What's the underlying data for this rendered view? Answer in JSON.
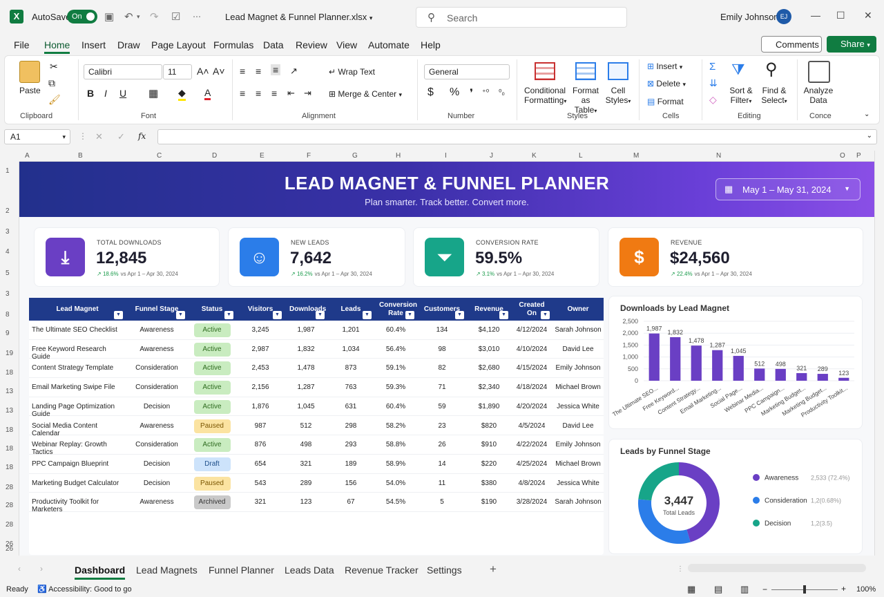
{
  "app": {
    "autosave_label": "AutoSave",
    "autosave_state": "On",
    "doc_title": "Lead Magnet & Funnel Planner.xlsx",
    "search_placeholder": "Search",
    "user_name": "Emily Johnson",
    "user_initials": "EJ",
    "brand_color": "#107c41"
  },
  "menu": [
    "File",
    "Home",
    "Insert",
    "Draw",
    "Page Layout",
    "Formulas",
    "Data",
    "Review",
    "View",
    "Automate",
    "Help"
  ],
  "menu_active": "Home",
  "actions": {
    "comments": "Comments",
    "share": "Share"
  },
  "ribbon": {
    "clipboard": {
      "paste": "Paste",
      "group": "Clipboard"
    },
    "font": {
      "name": "Calibri",
      "size": "11",
      "group": "Font"
    },
    "alignment": {
      "wrap": "Wrap Text",
      "merge": "Merge & Center",
      "group": "Alignment"
    },
    "number": {
      "format": "General",
      "group": "Number"
    },
    "styles": {
      "conditional": "Conditional",
      "conditional2": "Formatting",
      "format_as": "Format as",
      "format_as2": "Table",
      "cell": "Cell",
      "cell2": "Styles",
      "group": "Styles"
    },
    "cells": {
      "insert": "Insert",
      "delete": "Delete",
      "format": "Format",
      "group": "Cells"
    },
    "editing": {
      "sort": "Sort &",
      "sort2": "Filter",
      "find": "Find &",
      "find2": "Select",
      "group": "Editing"
    },
    "analysis": {
      "analyze": "Analyze",
      "analyze2": "Data",
      "group": "Conce"
    }
  },
  "formula_bar": {
    "name_box": "A1",
    "fx": "fx",
    "value": ""
  },
  "columns": [
    "A",
    "B",
    "C",
    "D",
    "E",
    "F",
    "G",
    "H",
    "I",
    "J",
    "K",
    "L",
    "M",
    "N",
    "O",
    "P"
  ],
  "rows": [
    "1",
    "2",
    "3",
    "4",
    "5",
    "3",
    "8",
    "9",
    "19",
    "18",
    "13",
    "13",
    "18",
    "18",
    "18",
    "28",
    "28",
    "28",
    "26",
    "26"
  ],
  "banner": {
    "title": "LEAD MAGNET & FUNNEL PLANNER",
    "subtitle": "Plan smarter. Track better. Convert more.",
    "date_range": "May 1 – May 31, 2024"
  },
  "kpis": [
    {
      "label": "TOTAL DOWNLOADS",
      "value": "12,845",
      "delta": "18.6%",
      "compare": "vs Apr 1 – Apr 30, 2024",
      "color": "#6a3fc4",
      "icon": "download-icon"
    },
    {
      "label": "NEW LEADS",
      "value": "7,642",
      "delta": "16.2%",
      "compare": "vs Apr 1 – Apr 30, 2024",
      "color": "#2b7de9",
      "icon": "users-icon"
    },
    {
      "label": "CONVERSION RATE",
      "value": "59.5%",
      "delta": "3.1%",
      "compare": "vs Apr 1 – Apr 30, 2024",
      "color": "#17a589",
      "icon": "funnel-icon"
    },
    {
      "label": "REVENUE",
      "value": "$24,560",
      "delta": "22.4%",
      "compare": "vs Apr 1 – Apr 30, 2024",
      "color": "#f07a12",
      "icon": "dollar-icon"
    }
  ],
  "table": {
    "headers": [
      "Lead Magnet",
      "Funnel Stage",
      "Status",
      "Visitors",
      "Downloads",
      "Leads",
      "Conversion Rate",
      "Customers",
      "Revenue",
      "Created On",
      "Owner"
    ],
    "rows": [
      [
        "The Ultimate SEO Checklist",
        "Awareness",
        "Active",
        "3,245",
        "1,987",
        "1,201",
        "60.4%",
        "134",
        "$4,120",
        "4/12/2024",
        "Sarah Johnson"
      ],
      [
        "Free Keyword Research Guide",
        "Awareness",
        "Active",
        "2,987",
        "1,832",
        "1,034",
        "56.4%",
        "98",
        "$3,010",
        "4/10/2024",
        "David Lee"
      ],
      [
        "Content Strategy Template",
        "Consideration",
        "Active",
        "2,453",
        "1,478",
        "873",
        "59.1%",
        "82",
        "$2,680",
        "4/15/2024",
        "Emily Johnson"
      ],
      [
        "Email Marketing Swipe File",
        "Consideration",
        "Active",
        "2,156",
        "1,287",
        "763",
        "59.3%",
        "71",
        "$2,340",
        "4/18/2024",
        "Michael Brown"
      ],
      [
        "Landing Page Optimization Guide",
        "Decision",
        "Active",
        "1,876",
        "1,045",
        "631",
        "60.4%",
        "59",
        "$1,890",
        "4/20/2024",
        "Jessica White"
      ],
      [
        "Social Media Content Calendar",
        "Awareness",
        "Paused",
        "987",
        "512",
        "298",
        "58.2%",
        "23",
        "$820",
        "4/5/2024",
        "David Lee"
      ],
      [
        "Webinar Replay: Growth Tactics",
        "Consideration",
        "Active",
        "876",
        "498",
        "293",
        "58.8%",
        "26",
        "$910",
        "4/22/2024",
        "Emily Johnson"
      ],
      [
        "PPC Campaign Blueprint",
        "Decision",
        "Draft",
        "654",
        "321",
        "189",
        "58.9%",
        "14",
        "$220",
        "4/25/2024",
        "Michael Brown"
      ],
      [
        "Marketing Budget Calculator",
        "Decision",
        "Paused",
        "543",
        "289",
        "156",
        "54.0%",
        "11",
        "$380",
        "4/8/2024",
        "Jessica White"
      ],
      [
        "Productivity Toolkit for Marketers",
        "Awareness",
        "Archived",
        "321",
        "123",
        "67",
        "54.5%",
        "5",
        "$190",
        "3/28/2024",
        "Sarah Johnson"
      ]
    ],
    "status_colors": {
      "Active": {
        "bg": "#c9ecc0",
        "fg": "#2e6b1f"
      },
      "Paused": {
        "bg": "#fbe3a1",
        "fg": "#7a5500"
      },
      "Draft": {
        "bg": "#cde3fb",
        "fg": "#1f4f8a"
      },
      "Archived": {
        "bg": "#c9c9c9",
        "fg": "#333333"
      }
    }
  },
  "chart_data": [
    {
      "type": "bar",
      "title": "Downloads by Lead Magnet",
      "categories": [
        "The Ultimate SEO...",
        "Free Keyword...",
        "Content Strategy...",
        "Email Marketing...",
        "Social Page...",
        "Webinar Media...",
        "PPC Campaign...",
        "Marketing Budget...",
        "Marketing Budget...",
        "Productivity Toolkit..."
      ],
      "values": [
        1987,
        1832,
        1478,
        1287,
        1045,
        512,
        498,
        321,
        289,
        123
      ],
      "yticks": [
        "0",
        "500",
        "1,000",
        "1,500",
        "2,000",
        "2,500"
      ],
      "ylim": [
        0,
        2500
      ],
      "color": "#6a3fc4"
    },
    {
      "type": "pie",
      "title": "Leads by Funnel Stage",
      "center_value": "3,447",
      "center_label": "Total Leads",
      "labels": [
        "Awareness",
        "Consideration",
        "Decision"
      ],
      "values": [
        1566,
        1070,
        811
      ],
      "value_labels": [
        "2,533 (72.4%)",
        "1,2(0.68%)",
        "1,2(3.5)"
      ],
      "colors": [
        "#6a3fc4",
        "#2b7de9",
        "#17a589"
      ]
    }
  ],
  "sheet_tabs": [
    "Dashboard",
    "Lead Magnets",
    "Funnel Planner",
    "Leads Data",
    "Revenue Tracker",
    "Settings"
  ],
  "sheet_tab_active": "Dashboard",
  "status": {
    "ready": "Ready",
    "accessibility": "Accessibility: Good to go",
    "zoom": "100%"
  }
}
